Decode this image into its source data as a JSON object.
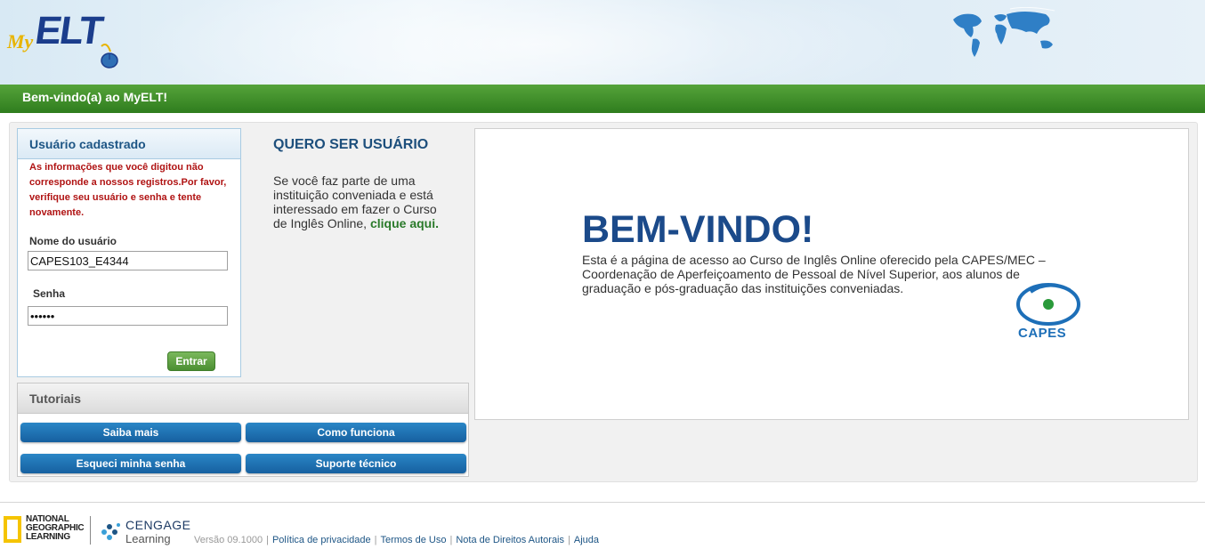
{
  "header": {
    "logo_my": "My",
    "logo_elt": "ELT"
  },
  "welcome_bar": {
    "title": "Bem-vindo(a) ao MyELT!"
  },
  "login": {
    "title": "Usuário cadastrado",
    "error": "As informações que você digitou não corresponde a nossos registros.Por favor, verifique seu usuário e senha e tente novamente.",
    "username_label": "Nome do usuário",
    "username_value": "CAPES103_E4344",
    "password_label": "Senha",
    "password_value": "••••••",
    "submit_label": "Entrar"
  },
  "tutorials": {
    "title": "Tutoriais",
    "buttons": [
      "Saiba mais",
      "Como funciona",
      "Esqueci minha senha",
      "Suporte técnico"
    ]
  },
  "signup": {
    "title": "QUERO SER USUÁRIO",
    "text": "Se você faz parte de uma instituição conveniada e está interessado em fazer o Curso de Inglês Online, ",
    "link": "clique aqui."
  },
  "welcome": {
    "title": "BEM-VINDO!",
    "text": "Esta é a página de acesso ao Curso de Inglês Online oferecido pela CAPES/MEC – Coordenação de Aperfeiçoamento de Pessoal de Nível Superior, aos alunos de graduação e pós-graduação das instituições conveniadas.",
    "capes_label": "CAPES"
  },
  "footer": {
    "ng_lines": [
      "NATIONAL",
      "GEOGRAPHIC",
      "LEARNING"
    ],
    "cengage_top": "CENGAGE",
    "cengage_bottom": "Learning",
    "version": "Versão 09.1000",
    "links": [
      "Política de privacidade",
      "Termos de Uso",
      "Nota de Direitos Autorais",
      "Ajuda"
    ]
  },
  "colors": {
    "green_bar": "#2f7d1e",
    "primary_blue": "#1660a0",
    "title_blue": "#1b4a8a",
    "error_red": "#b01313",
    "capes_green": "#2a9a3a"
  }
}
